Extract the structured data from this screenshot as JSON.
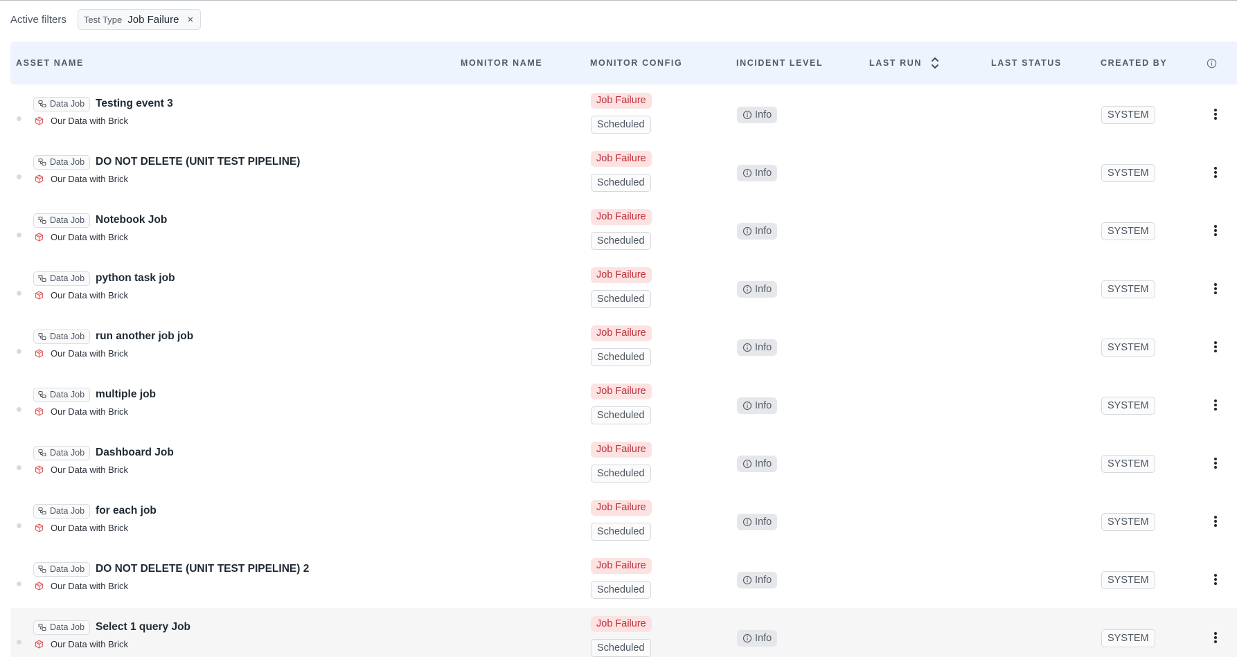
{
  "filters": {
    "label": "Active filters",
    "chip": {
      "key": "Test Type",
      "value": "Job Failure",
      "close": "×"
    }
  },
  "columns": {
    "asset_name": "ASSET NAME",
    "monitor_name": "MONITOR NAME",
    "monitor_config": "MONITOR CONFIG",
    "incident_level": "INCIDENT LEVEL",
    "last_run": "LAST RUN",
    "last_status": "LAST STATUS",
    "created_by": "CREATED BY"
  },
  "icons": {
    "sort": "sort-updown-icon",
    "column_info": "info-circle-icon",
    "asset_type": "link-icon",
    "source": "brick-cube-icon",
    "incident": "info-circle-icon",
    "row_menu": "kebab-vertical-icon"
  },
  "colors": {
    "header_bg": "#edf4fd",
    "failure_bg": "#fde2e2",
    "failure_text": "#c0303a",
    "source_icon": "#e05a5a"
  },
  "rows": [
    {
      "type": "Data Job",
      "name": "Testing event 3",
      "source": "Our Data with Brick",
      "config_primary": "Job Failure",
      "config_secondary": "Scheduled",
      "incident": "Info",
      "created_by": "SYSTEM"
    },
    {
      "type": "Data Job",
      "name": "DO NOT DELETE (UNIT TEST PIPELINE)",
      "source": "Our Data with Brick",
      "config_primary": "Job Failure",
      "config_secondary": "Scheduled",
      "incident": "Info",
      "created_by": "SYSTEM"
    },
    {
      "type": "Data Job",
      "name": "Notebook Job",
      "source": "Our Data with Brick",
      "config_primary": "Job Failure",
      "config_secondary": "Scheduled",
      "incident": "Info",
      "created_by": "SYSTEM"
    },
    {
      "type": "Data Job",
      "name": "python task job",
      "source": "Our Data with Brick",
      "config_primary": "Job Failure",
      "config_secondary": "Scheduled",
      "incident": "Info",
      "created_by": "SYSTEM"
    },
    {
      "type": "Data Job",
      "name": "run another job job",
      "source": "Our Data with Brick",
      "config_primary": "Job Failure",
      "config_secondary": "Scheduled",
      "incident": "Info",
      "created_by": "SYSTEM"
    },
    {
      "type": "Data Job",
      "name": "multiple job",
      "source": "Our Data with Brick",
      "config_primary": "Job Failure",
      "config_secondary": "Scheduled",
      "incident": "Info",
      "created_by": "SYSTEM"
    },
    {
      "type": "Data Job",
      "name": "Dashboard Job",
      "source": "Our Data with Brick",
      "config_primary": "Job Failure",
      "config_secondary": "Scheduled",
      "incident": "Info",
      "created_by": "SYSTEM"
    },
    {
      "type": "Data Job",
      "name": "for each job",
      "source": "Our Data with Brick",
      "config_primary": "Job Failure",
      "config_secondary": "Scheduled",
      "incident": "Info",
      "created_by": "SYSTEM"
    },
    {
      "type": "Data Job",
      "name": "DO NOT DELETE (UNIT TEST PIPELINE) 2",
      "source": "Our Data with Brick",
      "config_primary": "Job Failure",
      "config_secondary": "Scheduled",
      "incident": "Info",
      "created_by": "SYSTEM"
    },
    {
      "type": "Data Job",
      "name": "Select 1 query Job",
      "source": "Our Data with Brick",
      "config_primary": "Job Failure",
      "config_secondary": "Scheduled",
      "incident": "Info",
      "created_by": "SYSTEM"
    }
  ]
}
